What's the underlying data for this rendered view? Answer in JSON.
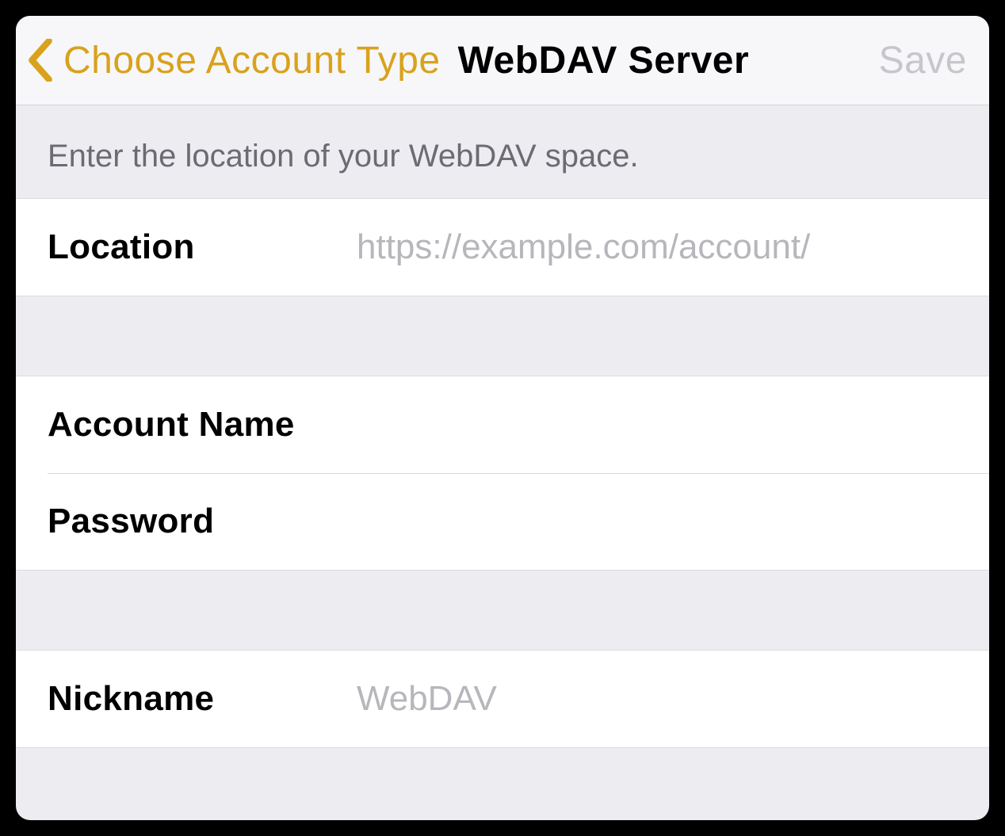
{
  "colors": {
    "accent": "#d9a21c",
    "disabled": "#c6c6cc",
    "placeholder": "#b6b6bc",
    "separator": "#dcdce0",
    "group_bg": "#ececf1",
    "row_bg": "#ffffff"
  },
  "nav": {
    "back_label": "Choose Account Type",
    "title": "WebDAV Server",
    "save_label": "Save"
  },
  "section1": {
    "header": "Enter the location of your WebDAV space.",
    "location": {
      "label": "Location",
      "value": "",
      "placeholder": "https://example.com/account/"
    }
  },
  "section2": {
    "account_name": {
      "label": "Account Name",
      "value": "",
      "placeholder": ""
    },
    "password": {
      "label": "Password",
      "value": "",
      "placeholder": ""
    }
  },
  "section3": {
    "nickname": {
      "label": "Nickname",
      "value": "",
      "placeholder": "WebDAV"
    }
  }
}
